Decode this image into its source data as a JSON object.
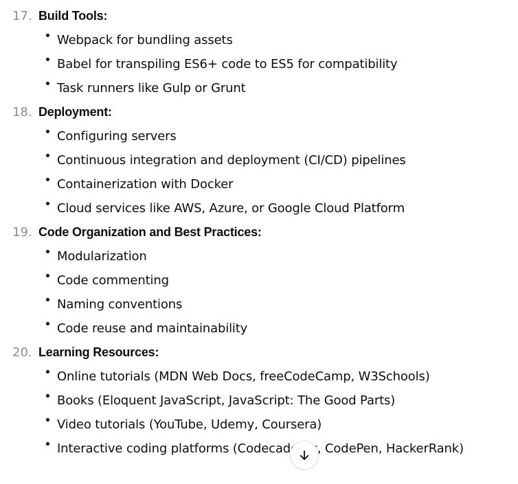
{
  "sections": [
    {
      "number": "17.",
      "title": "Build Tools:",
      "items": [
        "Webpack for bundling assets",
        "Babel for transpiling ES6+ code to ES5 for compatibility",
        "Task runners like Gulp or Grunt"
      ]
    },
    {
      "number": "18.",
      "title": "Deployment:",
      "items": [
        "Configuring servers",
        "Continuous integration and deployment (CI/CD) pipelines",
        "Containerization with Docker",
        "Cloud services like AWS, Azure, or Google Cloud Platform"
      ]
    },
    {
      "number": "19.",
      "title": "Code Organization and Best Practices:",
      "items": [
        "Modularization",
        "Code commenting",
        "Naming conventions",
        "Code reuse and maintainability"
      ]
    },
    {
      "number": "20.",
      "title": "Learning Resources:",
      "items": [
        "Online tutorials (MDN Web Docs, freeCodeCamp, W3Schools)",
        "Books (Eloquent JavaScript, JavaScript: The Good Parts)",
        "Video tutorials (YouTube, Udemy, Coursera)",
        "Interactive coding platforms (Codecademy, CodePen, HackerRank)"
      ]
    }
  ],
  "scroll_button": {
    "icon": "arrow-down-icon"
  },
  "colors": {
    "text": "#0d0d0d",
    "number": "#8e8e8e",
    "background": "#ffffff"
  }
}
